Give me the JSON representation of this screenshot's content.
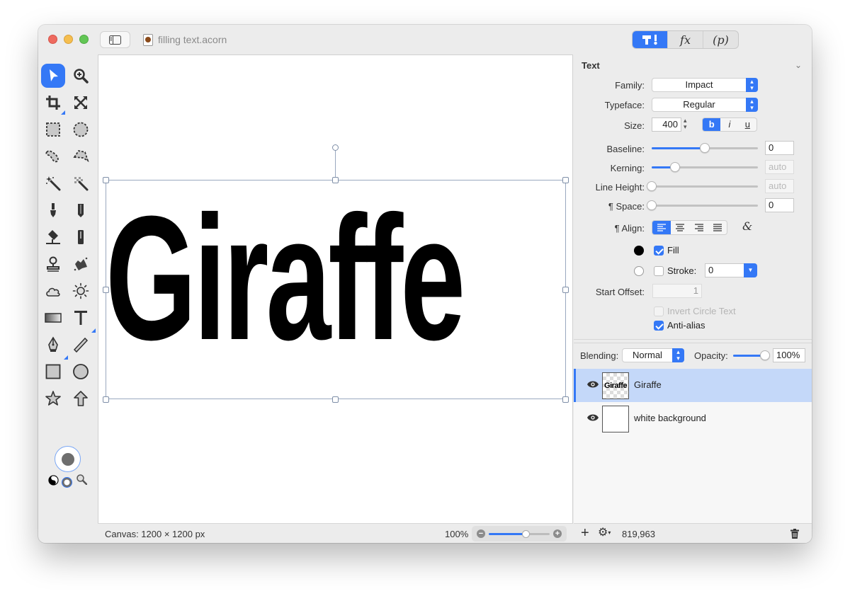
{
  "window": {
    "title": "filling text.acorn",
    "mode_tabs": [
      {
        "id": "tools",
        "label": "",
        "icon": "hammer-wrench-icon",
        "active": true
      },
      {
        "id": "effects",
        "label": "fx",
        "active": false
      },
      {
        "id": "properties",
        "label": "(p)",
        "active": false
      }
    ]
  },
  "tools": [
    {
      "name": "move-tool",
      "icon": "arrow-pointer-icon",
      "active": true
    },
    {
      "name": "zoom-tool",
      "icon": "magnifier-plus-icon"
    },
    {
      "name": "crop-tool",
      "icon": "crop-icon",
      "has_submenu": true
    },
    {
      "name": "transform-tool",
      "icon": "expand-arrows-icon"
    },
    {
      "name": "rect-select-tool",
      "icon": "dashed-rect-icon"
    },
    {
      "name": "ellipse-select-tool",
      "icon": "dashed-circle-icon"
    },
    {
      "name": "lasso-tool",
      "icon": "lasso-icon"
    },
    {
      "name": "polygon-lasso-tool",
      "icon": "polygon-lasso-icon"
    },
    {
      "name": "magic-wand-tool",
      "icon": "magic-wand-icon"
    },
    {
      "name": "instant-alpha-tool",
      "icon": "checker-wand-icon"
    },
    {
      "name": "brush-tool",
      "icon": "brush-icon"
    },
    {
      "name": "pencil-tool",
      "icon": "pencil-icon"
    },
    {
      "name": "paint-bucket-tool",
      "icon": "bucket-icon"
    },
    {
      "name": "eraser-tool",
      "icon": "eraser-icon"
    },
    {
      "name": "clone-tool",
      "icon": "stamp-icon"
    },
    {
      "name": "smudge-tool",
      "icon": "splatter-icon"
    },
    {
      "name": "shape-cloud-tool",
      "icon": "cloud-icon"
    },
    {
      "name": "burn-dodge-tool",
      "icon": "sun-icon"
    },
    {
      "name": "gradient-tool",
      "icon": "gradient-icon"
    },
    {
      "name": "text-tool",
      "icon": "text-t-icon",
      "has_submenu": true
    },
    {
      "name": "bezier-tool",
      "icon": "pen-nib-icon",
      "has_submenu": true
    },
    {
      "name": "line-tool",
      "icon": "line-icon"
    },
    {
      "name": "rectangle-tool",
      "icon": "square-icon"
    },
    {
      "name": "oval-tool",
      "icon": "circle-icon"
    },
    {
      "name": "star-tool",
      "icon": "star-icon"
    },
    {
      "name": "arrow-tool",
      "icon": "up-arrow-icon"
    }
  ],
  "colors": {
    "accent": "#3478f6",
    "fill_color": "#000000",
    "stroke_color": "#ffffff",
    "well_color": "#6e6e6e",
    "selection_row": "#c4d8f9"
  },
  "canvas": {
    "text": "Giraffe",
    "size_label": "Canvas: 1200 × 1200 px",
    "zoom_label": "100%",
    "zoom_level": 0.6
  },
  "text_panel": {
    "title": "Text",
    "family_label": "Family:",
    "family_value": "Impact",
    "typeface_label": "Typeface:",
    "typeface_value": "Regular",
    "size_label": "Size:",
    "size_value": "400",
    "style_buttons": [
      {
        "label": "b",
        "active": true
      },
      {
        "label": "i",
        "active": false
      },
      {
        "label": "u",
        "active": false
      }
    ],
    "baseline_label": "Baseline:",
    "baseline_value": "0",
    "baseline_slider": 0.5,
    "kerning_label": "Kerning:",
    "kerning_value": "auto",
    "kerning_slider": 0.22,
    "line_height_label": "Line Height:",
    "line_height_value": "auto",
    "line_height_slider": 0,
    "space_label": "¶ Space:",
    "space_value": "0",
    "space_slider": 0,
    "align_label": "¶ Align:",
    "align_options": [
      "left",
      "center",
      "right",
      "justify"
    ],
    "align_selected": "left",
    "fill_label": "Fill",
    "fill_checked": true,
    "stroke_label": "Stroke:",
    "stroke_checked": false,
    "stroke_value": "0",
    "start_offset_label": "Start Offset:",
    "start_offset_value": "1",
    "invert_circle_label": "Invert Circle Text",
    "invert_circle_checked": false,
    "antialias_label": "Anti-alias",
    "antialias_checked": true
  },
  "layers_panel": {
    "blending_label": "Blending:",
    "blending_value": "Normal",
    "opacity_label": "Opacity:",
    "opacity_value": "100%",
    "opacity_level": 1.0,
    "layers": [
      {
        "name": "Giraffe",
        "thumb_text": "Giraffe",
        "visible": true,
        "selected": true
      },
      {
        "name": "white background",
        "visible": true,
        "selected": false
      }
    ],
    "coordinates": "819,963"
  }
}
